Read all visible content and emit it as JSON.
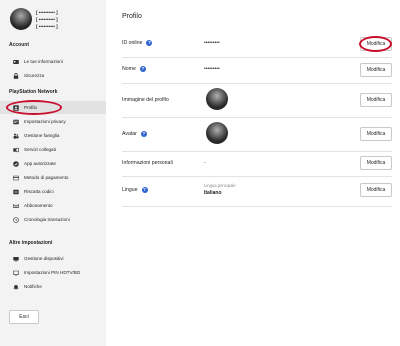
{
  "user": {
    "lines": [
      "[ •••••••••• ]",
      "[ •••••••••• ]",
      "[ •••••••••• ]"
    ]
  },
  "sidebar": {
    "account_header": "Account",
    "account_items": [
      {
        "label": "Le tue informazioni",
        "icon": "id-card-icon"
      },
      {
        "label": "Sicurezza",
        "icon": "lock-icon"
      }
    ],
    "psn_header": "PlayStation Network",
    "psn_items": [
      {
        "label": "Profilo",
        "icon": "profile-icon",
        "active": true
      },
      {
        "label": "Impostazioni privacy",
        "icon": "privacy-icon"
      },
      {
        "label": "Gestione famiglia",
        "icon": "family-icon"
      },
      {
        "label": "Servizi collegati",
        "icon": "link-icon"
      },
      {
        "label": "App autorizzate",
        "icon": "check-icon"
      },
      {
        "label": "Metodo di pagamento",
        "icon": "credit-card-icon"
      },
      {
        "label": "Riscatta codici",
        "icon": "code-icon"
      },
      {
        "label": "Abbonamento",
        "icon": "subscription-icon"
      },
      {
        "label": "Cronologia transazioni",
        "icon": "history-icon"
      }
    ],
    "other_header": "Altre impostazioni",
    "other_items": [
      {
        "label": "Gestione dispositivi",
        "icon": "device-icon"
      },
      {
        "label": "Impostazioni PIN HDTV/BD",
        "icon": "tv-icon"
      },
      {
        "label": "Notifiche",
        "icon": "bell-icon"
      }
    ],
    "logout_label": "Esci"
  },
  "main": {
    "title": "Profilo",
    "edit_label": "Modifica",
    "rows": [
      {
        "label": "ID online",
        "value": "•••••••••"
      },
      {
        "label": "Nome",
        "value": "•••••••••"
      },
      {
        "label": "Immagine del profilo"
      },
      {
        "label": "Avatar"
      },
      {
        "label": "Informazioni personali",
        "value": "-"
      },
      {
        "label": "Lingue",
        "sub_label": "Lingua principale",
        "value": "Italiano"
      }
    ]
  },
  "colors": {
    "highlight": "#c8102e",
    "help_icon": "#2d64d1",
    "sidebar_bg": "#f3f3f3"
  }
}
